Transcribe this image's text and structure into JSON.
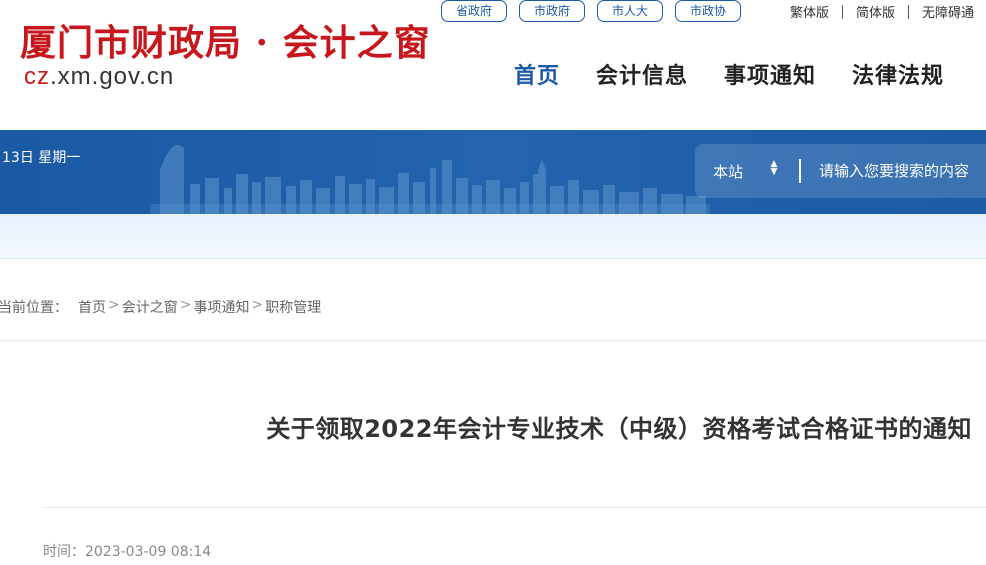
{
  "header": {
    "logo_title": "厦门市财政局 · 会计之窗",
    "logo_domain_prefix": "cz",
    "logo_domain_rest": ".xm.gov.cn",
    "gov_links": [
      "省政府",
      "市政府",
      "市人大",
      "市政协"
    ],
    "lang_links": [
      "繁体版",
      "简体版",
      "无障碍通"
    ],
    "nav": [
      {
        "label": "首页",
        "active": true
      },
      {
        "label": "会计信息",
        "active": false
      },
      {
        "label": "事项通知",
        "active": false
      },
      {
        "label": "法律法规",
        "active": false
      }
    ]
  },
  "banner": {
    "date": "13日 星期一",
    "search_scope": "本站",
    "search_placeholder": "请输入您要搜索的内容"
  },
  "breadcrumb": {
    "label": "当前位置：",
    "items": [
      "首页",
      "会计之窗",
      "事项通知",
      "职称管理"
    ],
    "separator": ">"
  },
  "article": {
    "title": "关于领取2022年会计专业技术（中级）资格考试合格证书的通知",
    "meta_label": "时间：",
    "meta_time": "2023-03-09 08:14"
  },
  "colors": {
    "brand_red": "#c8161d",
    "brand_blue": "#1c5aa6"
  }
}
